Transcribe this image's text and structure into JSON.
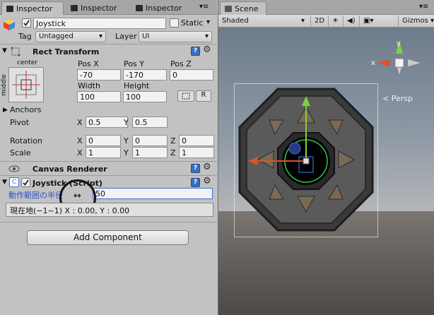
{
  "inspector": {
    "tabs": [
      {
        "label": "Inspector",
        "icon": "inspector-icon",
        "active": true
      },
      {
        "label": "Inspector",
        "icon": "inspector-icon",
        "active": false
      },
      {
        "label": "Inspector",
        "icon": "inspector-icon",
        "active": false
      }
    ],
    "object": {
      "name": "Joystick",
      "static_label": "Static",
      "tag_label": "Tag",
      "tag_value": "Untagged",
      "layer_label": "Layer",
      "layer_value": "UI"
    },
    "rect_transform": {
      "title": "Rect Transform",
      "anchor_h": "center",
      "anchor_v": "middle",
      "pos_x_label": "Pos X",
      "pos_y_label": "Pos Y",
      "pos_z_label": "Pos Z",
      "pos_x": "-70",
      "pos_y": "-170",
      "pos_z": "0",
      "width_label": "Width",
      "height_label": "Height",
      "width": "100",
      "height": "100",
      "r_button": "R",
      "anchors_label": "Anchors",
      "pivot_label": "Pivot",
      "pivot_x": "0.5",
      "pivot_y": "0.5",
      "rotation_label": "Rotation",
      "rotation": [
        "0",
        "0",
        "0"
      ],
      "scale_label": "Scale",
      "scale": [
        "1",
        "1",
        "1"
      ],
      "x": "X",
      "y": "Y",
      "z": "Z"
    },
    "canvas_renderer": {
      "title": "Canvas Renderer"
    },
    "joystick_script": {
      "title": "Joystick (Script)",
      "radius_label": "動作範囲の半径",
      "radius_value": "50",
      "status_text": "現在地(−1~1) X : 0.00, Y : 0.00"
    },
    "add_component": "Add Component"
  },
  "scene": {
    "tab": "Scene",
    "toolbar": {
      "shading": "Shaded",
      "mode_2d": "2D",
      "gizmos": "Gizmos"
    },
    "persp_label": "< Persp",
    "axis_x": "x",
    "axis_y": "y"
  },
  "colors": {
    "x_axis": "#e0502a",
    "y_axis": "#7fd23b",
    "selection_blue": "#3a6fd6",
    "joystick_ring": "#2ecc40"
  }
}
